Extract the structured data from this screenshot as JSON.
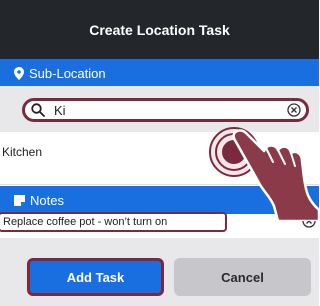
{
  "header": {
    "title": "Create Location Task"
  },
  "sub_location": {
    "section_label": "Sub-Location",
    "section_icon": "location-pin-icon",
    "search": {
      "value": "Ki",
      "icon": "search-icon",
      "clear_icon": "clear-circle-icon"
    },
    "results": [
      {
        "label": "Kitchen"
      }
    ]
  },
  "notes": {
    "section_label": "Notes",
    "section_icon": "note-icon",
    "value": "Replace coffee pot - won’t turn on",
    "clear_icon": "clear-circle-icon"
  },
  "footer": {
    "add_label": "Add Task",
    "cancel_label": "Cancel"
  },
  "colors": {
    "header_bg": "#23262b",
    "accent_blue": "#1a6fe0",
    "highlight": "#7b2a3e",
    "footer_bg": "#e8e8ea"
  }
}
